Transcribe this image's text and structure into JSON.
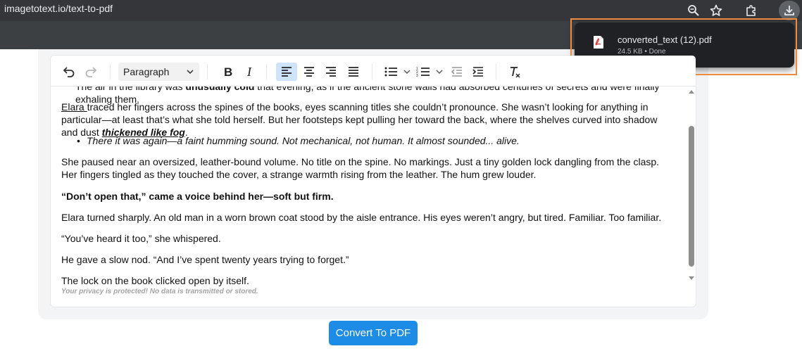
{
  "browser": {
    "url": "imagetotext.io/text-to-pdf"
  },
  "download": {
    "filename": "converted_text (12).pdf",
    "meta": "24.5 KB • Done",
    "highlight_color": "#f08a3c"
  },
  "editor": {
    "heading_select": "Paragraph",
    "toolbar_icons": [
      "undo-icon",
      "redo-icon",
      "bold-icon",
      "italic-icon",
      "align-left-icon",
      "align-center-icon",
      "align-right-icon",
      "align-justify-icon",
      "bulleted-list-icon",
      "numbered-list-icon",
      "outdent-icon",
      "indent-icon",
      "remove-format-icon"
    ],
    "p0_a": "The air in the library was ",
    "p0_b": "unusually cold",
    "p0_c": " that evening, as if the ancient stone walls had absorbed centuries of secrets and were finally exhaling them.",
    "p1_name": "Elara ",
    "p1_a": "traced her fingers across the spines of the books, eyes scanning titles she couldn’t pronounce. She wasn’t looking for anything in particular—at least that’s what she told herself. But her footsteps kept pulling her toward the back, where the shelves curved into shadow and dust ",
    "p1_em": "thickened like fog",
    "p1_end": ".",
    "p2": "There it was again—a faint humming sound. Not mechanical, not human. It almost sounded... alive.",
    "p3": "She paused near an oversized, leather-bound volume. No title on the spine. No markings. Just a tiny golden lock dangling from the clasp. Her fingers tingled as they touched the cover, a strange warmth rising from the leather. The hum grew louder.",
    "p4": "“Don’t open that,” came a voice behind her—soft but firm.",
    "p5": "Elara turned sharply. An old man in a worn brown coat stood by the aisle entrance. His eyes weren’t angry, but tired. Familiar. Too familiar.",
    "p6": "“You’ve heard it too,” she whispered.",
    "p7": "He gave a slow nod. “And I’ve spent twenty years trying to forget.”",
    "p8": "The lock on the book clicked open by itself.",
    "privacy": "Your privacy is protected! No data is transmitted or stored."
  },
  "actions": {
    "convert_label": "Convert To PDF"
  },
  "colors": {
    "primary_button": "#1d8ce6",
    "active_tool": "#cfe3fb"
  }
}
